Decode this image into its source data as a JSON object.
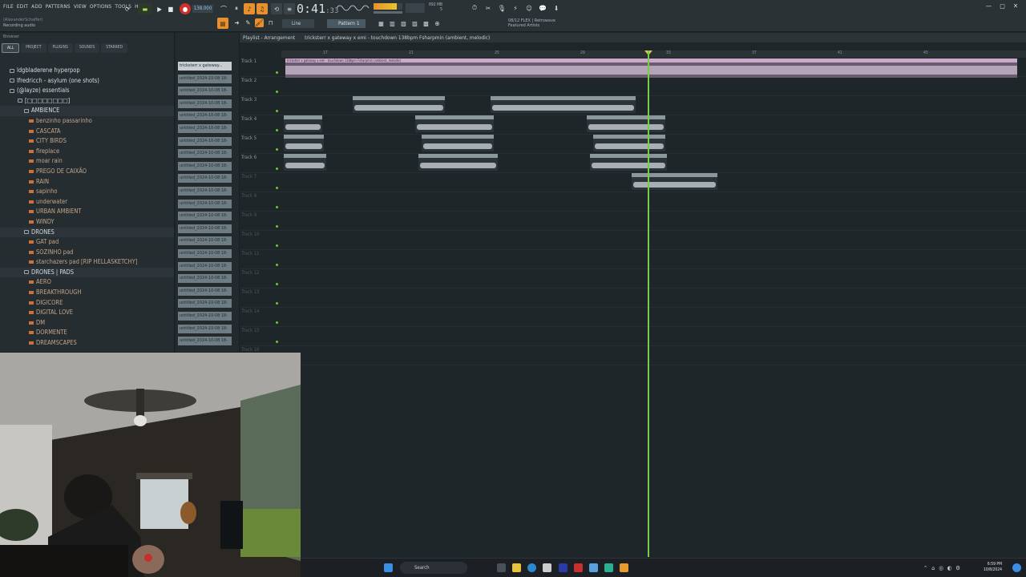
{
  "menu": [
    "FILE",
    "EDIT",
    "ADD",
    "PATTERNS",
    "VIEW",
    "OPTIONS",
    "TOOLS",
    "HELP"
  ],
  "hint": {
    "line1": "(AlexanderSchaffer)",
    "line2": "Recording audio"
  },
  "transport": {
    "time_main": "0:41",
    "time_sub": ":33",
    "tempo": "138.000"
  },
  "pattern_label": "Pattern 1",
  "snap_label": "Line",
  "cpu": {
    "line1": "892 MB",
    "line2": "5"
  },
  "news": {
    "line1": "08/12  FLEX | Retrowave",
    "line2": "Featured Artists"
  },
  "browser": {
    "title": "Browser",
    "tabs": [
      "ALL",
      "PROJECT",
      "PLUGINS",
      "SOUNDS",
      "STARRED"
    ],
    "items": [
      {
        "label": "ldgbladerene hyperpop",
        "kind": "folder"
      },
      {
        "label": "lfredricch - asylum (one shots)",
        "kind": "folder"
      },
      {
        "label": "(@layze) essentials",
        "kind": "folder"
      },
      {
        "label": "[□□□□□□□□]",
        "kind": "folder"
      },
      {
        "label": "AMBIENCE",
        "kind": "folder"
      },
      {
        "label": "benzinho passarinho",
        "kind": "file"
      },
      {
        "label": "CASCATA",
        "kind": "file"
      },
      {
        "label": "CITY BIRDS",
        "kind": "file"
      },
      {
        "label": "fireplace",
        "kind": "file"
      },
      {
        "label": "moar rain",
        "kind": "file"
      },
      {
        "label": "PREGO DE CAIXÃO",
        "kind": "file"
      },
      {
        "label": "RAIN",
        "kind": "file"
      },
      {
        "label": "sapinho",
        "kind": "file"
      },
      {
        "label": "underwater",
        "kind": "file"
      },
      {
        "label": "URBAN AMBIENT",
        "kind": "file"
      },
      {
        "label": "WINDY",
        "kind": "file"
      },
      {
        "label": "DRONES",
        "kind": "folder"
      },
      {
        "label": "GAT pad",
        "kind": "file"
      },
      {
        "label": "SOZINHO pad",
        "kind": "file"
      },
      {
        "label": "starchazers pad [RIP HELLASKETCHY]",
        "kind": "file"
      },
      {
        "label": "DRONES | PADS",
        "kind": "folder"
      },
      {
        "label": "AERO",
        "kind": "file"
      },
      {
        "label": "BREAKTHROUGH",
        "kind": "file"
      },
      {
        "label": "DIGICORE",
        "kind": "file"
      },
      {
        "label": "DIGITAL LOVE",
        "kind": "file"
      },
      {
        "label": "DM",
        "kind": "file"
      },
      {
        "label": "DORMENTE",
        "kind": "file"
      },
      {
        "label": "DREAMSCAPES",
        "kind": "file"
      }
    ]
  },
  "channels": [
    "tricksterr x gateway...",
    "untitled_2024-10-08 18-",
    "untitled_2024-10-08 18-",
    "untitled_2024-10-08 18-",
    "untitled_2024-10-08 18-",
    "untitled_2024-10-08 18-",
    "untitled_2024-10-08 18-",
    "untitled_2024-10-08 18-",
    "untitled_2024-10-08 18-",
    "untitled_2024-10-08 18-",
    "untitled_2024-10-08 18-",
    "untitled_2024-10-08 18-",
    "untitled_2024-10-08 18-",
    "untitled_2024-10-08 18-",
    "untitled_2024-10-08 18-",
    "untitled_2024-10-08 18-",
    "untitled_2024-10-08 18-",
    "untitled_2024-10-08 18-",
    "untitled_2024-10-08 18-",
    "untitled_2024-10-08 18-",
    "untitled_2024-10-08 18-",
    "untitled_2024-10-08 18-",
    "untitled_2024-10-08 18-"
  ],
  "playlist": {
    "title": "Playlist - Arrangement",
    "song_title": "tricksterr x gateway x emi - touchdown 138bpm Fsharpmin (ambient, melodic)",
    "ruler": [
      "17",
      "21",
      "25",
      "29",
      "33",
      "37",
      "41",
      "45"
    ],
    "tracks": [
      "Track 1",
      "Track 2",
      "Track 3",
      "Track 4",
      "Track 5",
      "Track 6",
      "Track 7",
      "Track 8",
      "Track 9",
      "Track 10",
      "Track 11",
      "Track 12",
      "Track 13",
      "Track 14",
      "Track 15",
      "Track 16"
    ],
    "main_clip_label": "tricksterr x gateway x emi - touchdown 138bpm Fsharpmin (ambient, melodic)",
    "clips": [
      {
        "track": 2,
        "label": "untitled_2024-10-08 18-30-47_Insert 1"
      },
      {
        "track": 2,
        "label": "untitled_2024-10-08 18-29-26_Insert 1"
      },
      {
        "track": 3,
        "label": "untitled_Insert 1"
      },
      {
        "track": 3,
        "label": "untitled_2024-10-08 18-37-51_Insert 1"
      },
      {
        "track": 3,
        "label": "untitled_2024-10-08 18-37-51_Insert 1"
      },
      {
        "track": 4,
        "label": "untitled_Insert 1"
      },
      {
        "track": 4,
        "label": "untitled_2024-10-8 18-38-05_Insert 1"
      },
      {
        "track": 4,
        "label": "untitled_2024-10-8 18-38-02_Insert 1"
      },
      {
        "track": 5,
        "label": "untitled_..._Insert 1"
      },
      {
        "track": 5,
        "label": "untitled_2024-10-08 18-38-06_Insert 1"
      },
      {
        "track": 5,
        "label": "untitled_2024-10-08 18-38-06_Insert 1"
      },
      {
        "track": 6,
        "label": "untitled_2024-10-08 18-39-33_Insert 1"
      }
    ]
  },
  "taskbar": {
    "search": "Search",
    "time": "6:59 PM",
    "date": "10/8/2024"
  },
  "colors": {
    "accent_orange": "#e8902e",
    "record_red": "#cf3030",
    "playhead_green": "#77d043",
    "main_clip": "#6b5b6f"
  }
}
